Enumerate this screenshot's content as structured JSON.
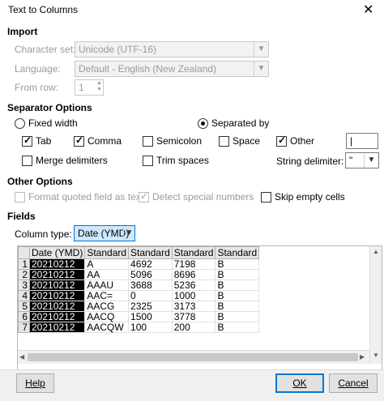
{
  "window": {
    "title": "Text to Columns",
    "close_glyph": "✕"
  },
  "import": {
    "heading": "Import",
    "charset_label": "Character set:",
    "charset_value": "Unicode (UTF-16)",
    "language_label": "Language:",
    "language_value": "Default - English (New Zealand)",
    "fromrow_label": "From row:",
    "fromrow_value": "1"
  },
  "separator": {
    "heading": "Separator Options",
    "fixed_width": "Fixed width",
    "separated_by": "Separated by",
    "tab": "Tab",
    "comma": "Comma",
    "semicolon": "Semicolon",
    "space": "Space",
    "other": "Other",
    "other_value": "|",
    "merge": "Merge delimiters",
    "trim": "Trim spaces",
    "string_delim_label": "String delimiter:",
    "string_delim_value": "\""
  },
  "other_options": {
    "heading": "Other Options",
    "format_quoted": "Format quoted field as text",
    "detect_special": "Detect special numbers",
    "skip_empty": "Skip empty cells"
  },
  "fields": {
    "heading": "Fields",
    "column_type_label": "Column type:",
    "column_type_value": "Date (YMD)",
    "headers": [
      "Date (YMD)",
      "Standard",
      "Standard",
      "Standard",
      "Standard"
    ],
    "rows": [
      [
        "1",
        "20210212",
        "A",
        "4692",
        "7198",
        "B"
      ],
      [
        "2",
        "20210212",
        "AA",
        "5096",
        "8696",
        "B"
      ],
      [
        "3",
        "20210212",
        "AAAU",
        "3688",
        "5236",
        "B"
      ],
      [
        "4",
        "20210212",
        "AAC=",
        "0",
        "1000",
        "B"
      ],
      [
        "5",
        "20210212",
        "AACG",
        "2325",
        "3173",
        "B"
      ],
      [
        "6",
        "20210212",
        "AACQ",
        "1500",
        "3778",
        "B"
      ],
      [
        "7",
        "20210212",
        "AACQW",
        "100",
        "200",
        "B"
      ]
    ]
  },
  "buttons": {
    "help": "Help",
    "ok": "OK",
    "cancel": "Cancel"
  }
}
